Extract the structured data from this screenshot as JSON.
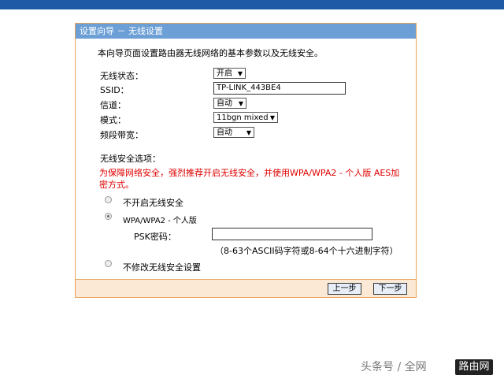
{
  "panel": {
    "title": "设置向导 － 无线设置",
    "intro": "本向导页面设置路由器无线网络的基本参数以及无线安全。"
  },
  "fields": {
    "wireless_status": {
      "label": "无线状态：",
      "value": "开启"
    },
    "ssid": {
      "label": "SSID：",
      "value": "TP-LINK_443BE4"
    },
    "channel": {
      "label": "信道：",
      "value": "自动"
    },
    "mode": {
      "label": "模式：",
      "value": "11bgn mixed"
    },
    "bandwidth": {
      "label": "频段带宽：",
      "value": "自动"
    }
  },
  "security": {
    "heading": "无线安全选项：",
    "warning": "为保障网络安全，强烈推荐开启无线安全，并使用WPA/WPA2 - 个人版 AES加密方式。",
    "options": [
      {
        "label": "不开启无线安全",
        "checked": false
      },
      {
        "label": "WPA/WPA2 - 个人版",
        "checked": true
      },
      {
        "label": "不修改无线安全设置",
        "checked": false
      }
    ],
    "psk_label": "PSK密码：",
    "psk_value": "",
    "psk_hint": "（8-63个ASCII码字符或8-64个十六进制字符）"
  },
  "buttons": {
    "prev": "上一步",
    "next": "下一步"
  },
  "watermark": {
    "text": "头条号 / 全网",
    "logo": "路由网"
  },
  "colors": {
    "topbar": "#1f5aa6",
    "title_bar": "#6b9fd6",
    "panel_border": "#e7a25a",
    "warning": "#e00000"
  }
}
